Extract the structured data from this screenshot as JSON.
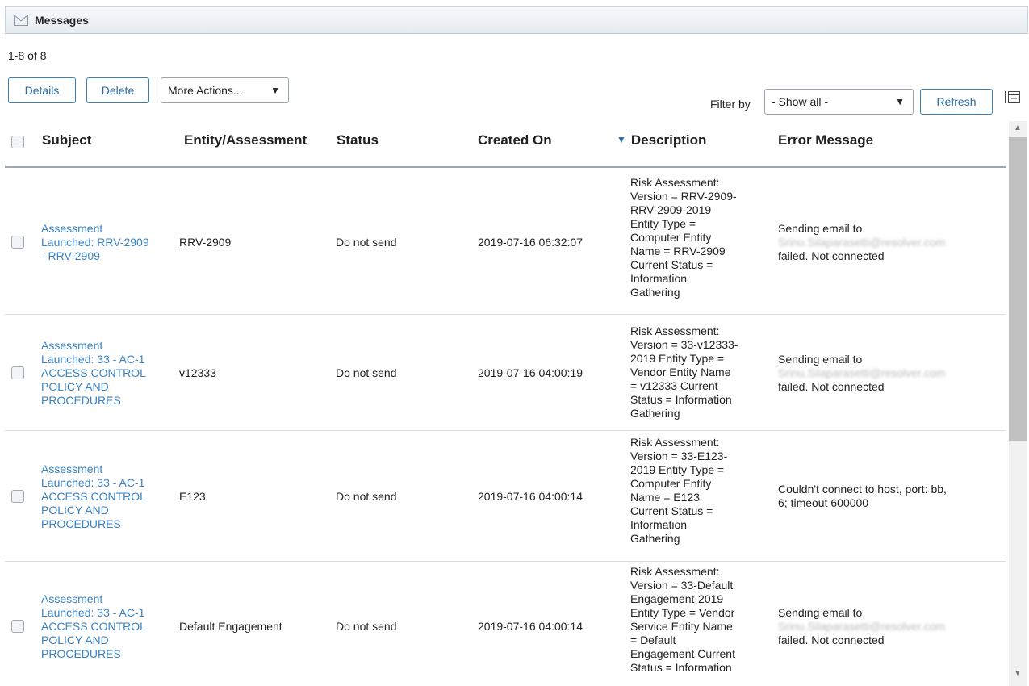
{
  "panel": {
    "title": "Messages",
    "icon": "envelope-icon"
  },
  "pager": {
    "count_text": "1-8 of 8"
  },
  "toolbar": {
    "details_label": "Details",
    "delete_label": "Delete",
    "more_actions_label": "More Actions...",
    "filter_label": "Filter by",
    "filter_value": "- Show all -",
    "refresh_label": "Refresh",
    "columns_icon": "column-chooser-icon"
  },
  "table": {
    "headers": {
      "subject": "Subject",
      "entity": "Entity/Assessment",
      "status": "Status",
      "created": "Created On",
      "description": "Description",
      "error": "Error Message"
    },
    "sort": {
      "column": "description",
      "direction": "descending"
    },
    "rows": [
      {
        "subject": [
          "Assessment",
          "Launched: RRV-2909",
          "- RRV-2909"
        ],
        "entity": "RRV-2909",
        "status": "Do not send",
        "created": "2019-07-16 06:32:07",
        "description": [
          "Risk Assessment:",
          "Version = RRV-2909-",
          "RRV-2909-2019",
          "Entity Type =",
          "Computer Entity",
          "Name = RRV-2909",
          "Current Status =",
          "Information",
          "Gathering"
        ],
        "error": [
          "Sending email to",
          "Srinu.Silaparasetti@resolver.com",
          "failed. Not connected"
        ],
        "error_blurred_line": 1
      },
      {
        "subject": [
          "Assessment",
          "Launched: 33 - AC-1",
          "ACCESS CONTROL",
          "POLICY AND",
          "PROCEDURES"
        ],
        "entity": "v12333",
        "status": "Do not send",
        "created": "2019-07-16 04:00:19",
        "description": [
          "Risk Assessment:",
          "Version = 33-v12333-",
          "2019 Entity Type =",
          "Vendor Entity Name",
          "= v12333 Current",
          "Status = Information",
          "Gathering"
        ],
        "error": [
          "Sending email to",
          "Srinu.Silaparasetti@resolver.com",
          "failed. Not connected"
        ],
        "error_blurred_line": 1
      },
      {
        "subject": [
          "Assessment",
          "Launched: 33 - AC-1",
          "ACCESS CONTROL",
          "POLICY AND",
          "PROCEDURES"
        ],
        "entity": "E123",
        "status": "Do not send",
        "created": "2019-07-16 04:00:14",
        "description": [
          "Risk Assessment:",
          "Version = 33-E123-",
          "2019 Entity Type =",
          "Computer Entity",
          "Name = E123",
          "Current Status =",
          "Information",
          "Gathering"
        ],
        "error": [
          "Couldn't connect to host, port: bb,",
          "6; timeout 600000"
        ],
        "error_blurred_line": -1
      },
      {
        "subject": [
          "Assessment",
          "Launched: 33 - AC-1",
          "ACCESS CONTROL",
          "POLICY AND",
          "PROCEDURES"
        ],
        "entity": "Default Engagement",
        "status": "Do not send",
        "created": "2019-07-16 04:00:14",
        "description": [
          "Risk Assessment:",
          "Version = 33-Default",
          "Engagement-2019",
          "Entity Type = Vendor",
          "Service Entity Name",
          "= Default",
          "Engagement Current",
          "Status = Information"
        ],
        "error": [
          "Sending email to",
          "Srinu.Silaparasetti@resolver.com",
          "failed. Not connected"
        ],
        "error_blurred_line": 1
      }
    ]
  }
}
